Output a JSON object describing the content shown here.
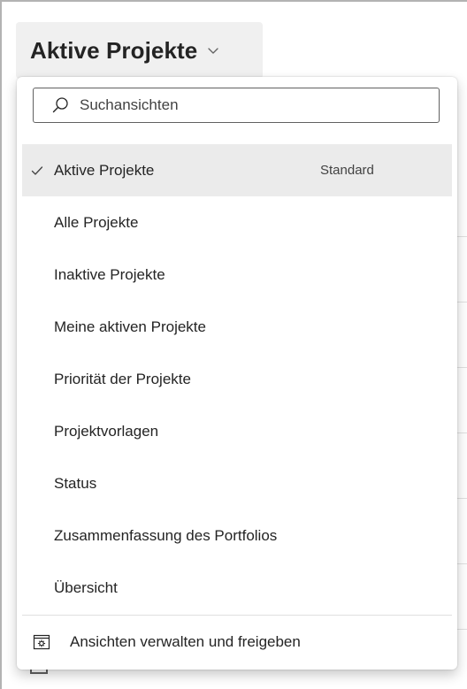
{
  "header": {
    "title": "Aktive Projekte"
  },
  "search": {
    "placeholder": "Suchansichten",
    "value": ""
  },
  "views": [
    {
      "label": "Aktive Projekte",
      "badge": "Standard",
      "selected": true
    },
    {
      "label": "Alle Projekte"
    },
    {
      "label": "Inaktive Projekte"
    },
    {
      "label": "Meine aktiven Projekte"
    },
    {
      "label": "Priorität der Projekte"
    },
    {
      "label": "Projektvorlagen"
    },
    {
      "label": "Status"
    },
    {
      "label": "Zusammenfassung des Portfolios"
    },
    {
      "label": "Übersicht"
    }
  ],
  "footer": {
    "manage_label": "Ansichten verwalten und freigeben"
  },
  "icons": {
    "header_chevron": "chevron-down-icon",
    "search": "search-icon",
    "selected_check": "checkmark-icon",
    "manage": "manage-views-icon"
  },
  "colors": {
    "header_bg": "#f0f0f0",
    "selected_bg": "#ebebeb",
    "text": "#242424"
  }
}
